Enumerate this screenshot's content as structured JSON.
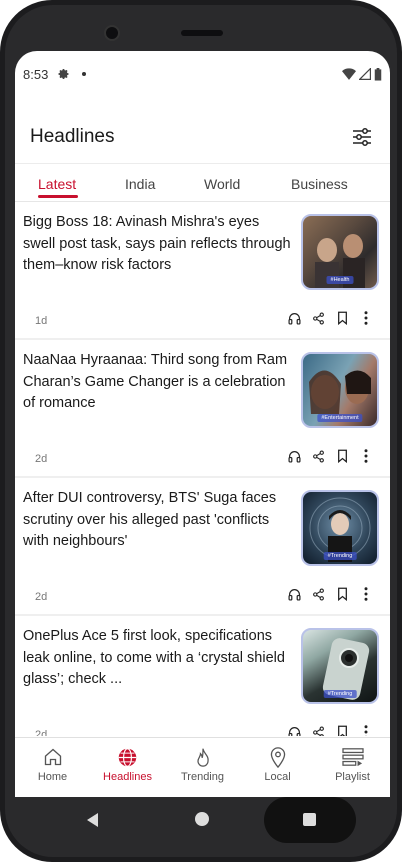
{
  "status_bar": {
    "time": "8:53"
  },
  "header": {
    "title": "Headlines"
  },
  "tabs": [
    {
      "label": "Latest",
      "active": true
    },
    {
      "label": "India",
      "active": false
    },
    {
      "label": "World",
      "active": false
    },
    {
      "label": "Business",
      "active": false
    }
  ],
  "articles": [
    {
      "title": "Bigg Boss 18: Avinash Mishra's eyes swell post task, says pain reflects through them–know risk factors",
      "age": "1d",
      "tag": "#Health"
    },
    {
      "title": "NaaNaa Hyraanaa: Third song from Ram Charan’s Game Changer is a celebration of  romance",
      "age": "2d",
      "tag": "#Entertainment"
    },
    {
      "title": "After DUI controversy, BTS' Suga faces scrutiny over his alleged past 'conflicts with neighbours'",
      "age": "2d",
      "tag": "#Trending"
    },
    {
      "title": "OnePlus Ace 5 first look, specifications leak online, to come with a ‘crystal shield glass’; check ...",
      "age": "2d",
      "tag": "#Trending"
    }
  ],
  "bottom_nav": [
    {
      "label": "Home",
      "icon": "home-icon",
      "active": false
    },
    {
      "label": "Headlines",
      "icon": "globe-icon",
      "active": true
    },
    {
      "label": "Trending",
      "icon": "flame-icon",
      "active": false
    },
    {
      "label": "Local",
      "icon": "location-pin-icon",
      "active": false
    },
    {
      "label": "Playlist",
      "icon": "playlist-icon",
      "active": false
    }
  ],
  "colors": {
    "accent": "#c8102e",
    "thumb_border": "#b9c2e8"
  }
}
